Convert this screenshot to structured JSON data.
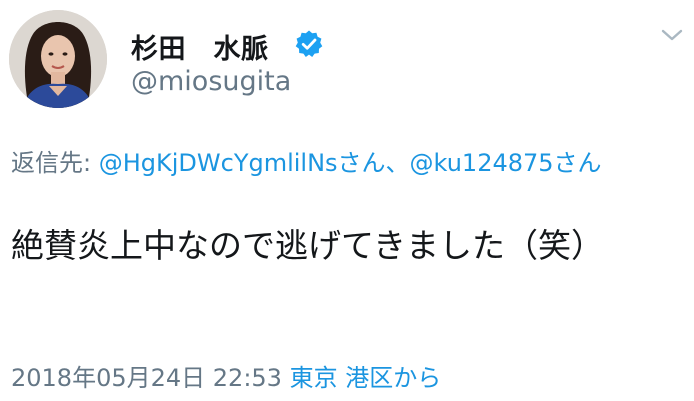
{
  "user": {
    "display_name": "杉田　水脈",
    "handle": "@miosugita",
    "verified": true
  },
  "reply": {
    "prefix": "返信先: ",
    "mention_1": "@HgKjDWcYgmlilNs",
    "suffix_1": "さん、",
    "mention_2": "@ku124875",
    "suffix_2": "さん"
  },
  "tweet": {
    "text": "絶賛炎上中なので逃げてきました（笑）"
  },
  "meta": {
    "timestamp": "2018年05月24日 22:53",
    "place": "東京 港区",
    "from_suffix": "から"
  },
  "icons": {
    "verified": "verified-badge-icon",
    "caret": "chevron-down-icon"
  },
  "colors": {
    "accent": "#1b95e0",
    "secondary_text": "#657786",
    "primary_text": "#14171a"
  }
}
